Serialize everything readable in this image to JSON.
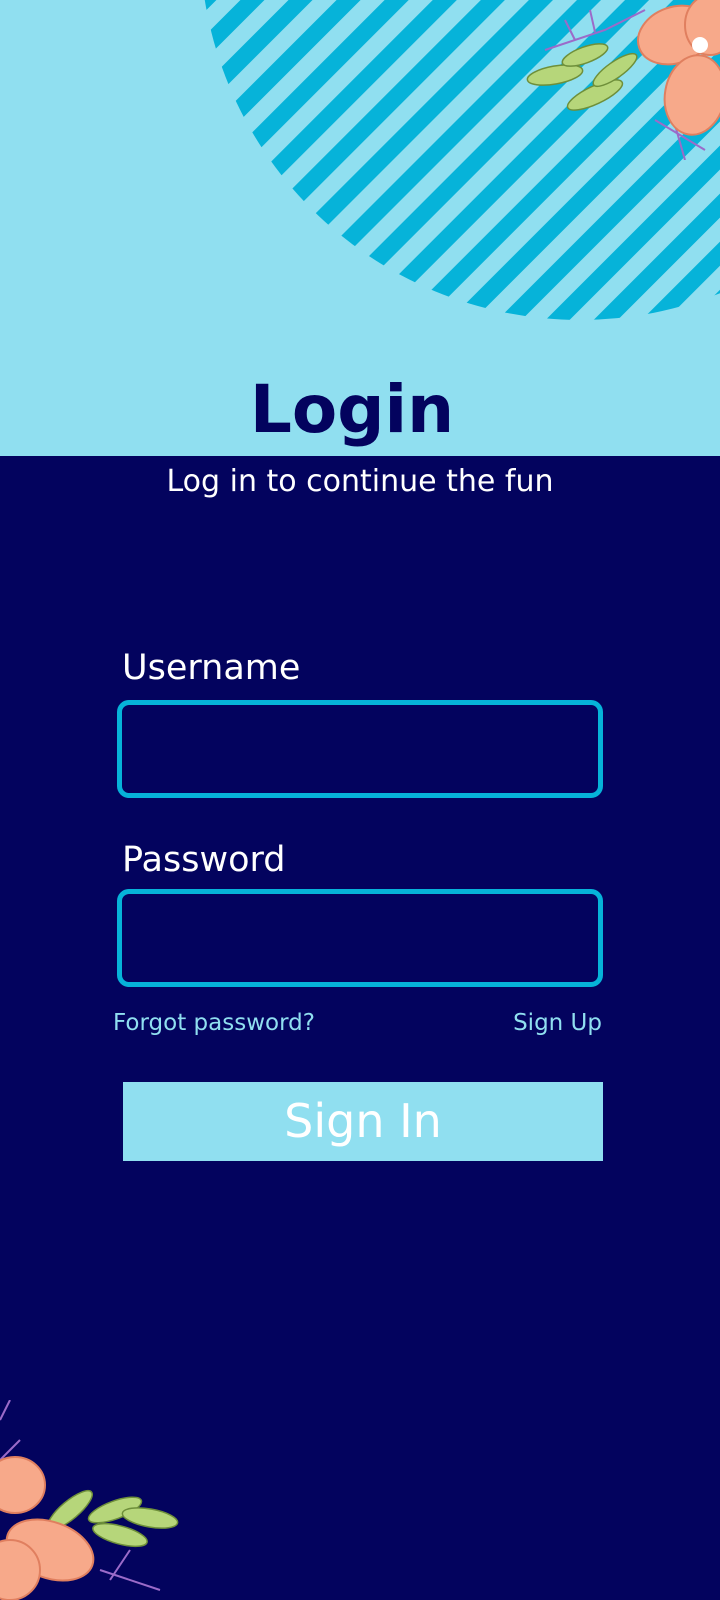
{
  "colors": {
    "background": "#03035e",
    "header_band": "#90dff0",
    "accent": "#06b3d9",
    "button": "#90dff0"
  },
  "header": {
    "title": "Login",
    "subtitle": "Log in to continue the fun"
  },
  "form": {
    "username_label": "Username",
    "username_value": "",
    "password_label": "Password",
    "password_value": "",
    "forgot_password_link": "Forgot password?",
    "signup_link": "Sign Up",
    "signin_button": "Sign In"
  },
  "decorations": {
    "top_right": "flower-icon",
    "bottom_left": "flower-icon",
    "stripes": "striped-circle"
  }
}
